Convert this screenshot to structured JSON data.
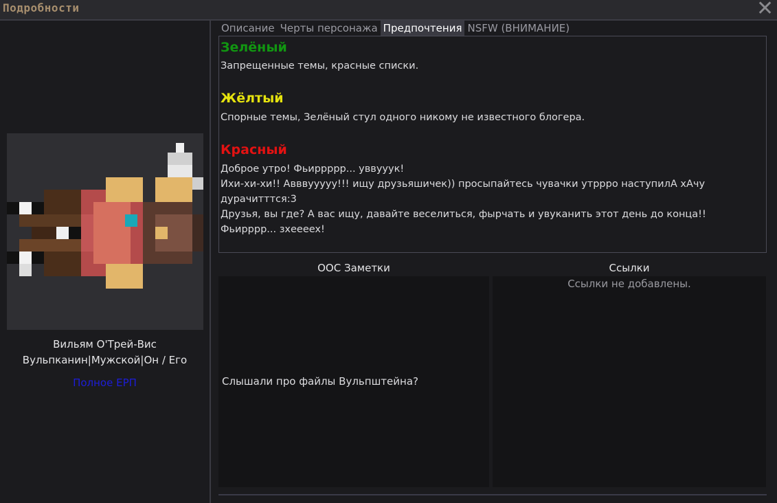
{
  "window": {
    "title": "Подробности",
    "close_icon": "close-icon"
  },
  "character": {
    "name": "Вильям О'Трей-Вис",
    "info": "Вульпканин|Мужской|Он / Его",
    "erp_link": "Полное ЕРП"
  },
  "tabs": [
    {
      "label": "Описание",
      "active": false
    },
    {
      "label": "Черты персонажа",
      "active": false
    },
    {
      "label": "Предпочтения",
      "active": true
    },
    {
      "label": "NSFW (ВНИМАНИЕ)",
      "active": false
    }
  ],
  "preferences": {
    "green": {
      "heading": "Зелёный",
      "text": "Запрещенные темы, красные списки.",
      "color": "#119611"
    },
    "yellow": {
      "heading": "Жёлтый",
      "text": "Спорные темы, Зелёный стул одного никому не известного блогера.",
      "color": "#e6e30e"
    },
    "red": {
      "heading": "Красный",
      "lines": [
        "Доброе утро! Фьиррррр... уввууук!",
        "Ихи-хи-хи!! Аввву​уууу!!! ищу друзьяшичек)) просыпайтесь чувачки утрррo наступилА хАчу",
        "дурачитттся:3",
        "Друзья, вы где?  А вас ищу, давайте веселиться, фырчать и увуканить этот день до конца!!",
        "Фьирррр... зхееeex!"
      ],
      "color": "#e31212"
    }
  },
  "ooc": {
    "title": "ООС Заметки",
    "text": "Слышали про файлы Вульпштейна?"
  },
  "links": {
    "title": "Ссылки",
    "empty_text": "Ссылки не добавлены."
  }
}
